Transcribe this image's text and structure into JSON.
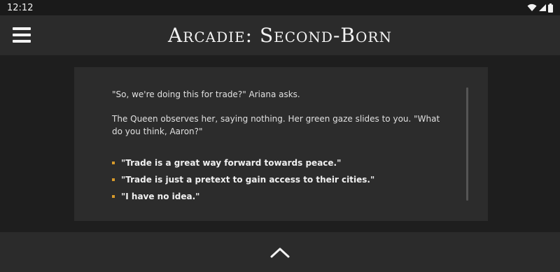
{
  "status_bar": {
    "time": "12:12",
    "icons": [
      "wifi-icon",
      "signal-icon",
      "battery-icon"
    ]
  },
  "app_bar": {
    "title": "Arcadie: Second-Born",
    "menu_icon": "hamburger-menu-icon"
  },
  "story": {
    "paragraphs": [
      "\"So, we're doing this for trade?\" Ariana asks.",
      "The Queen observes her, saying nothing. Her green gaze slides to you. \"What do you think, Aaron?\""
    ],
    "choices": [
      "\"Trade is a great way forward towards peace.\"",
      "\"Trade is just a pretext to gain access to their cities.\"",
      "\"I have no idea.\""
    ]
  },
  "bottom_bar": {
    "icon": "chevron-up-icon"
  },
  "colors": {
    "accent": "#d79a2b",
    "background": "#1e1e1e",
    "bar": "#2b2b2b",
    "card": "#2c2c2c"
  }
}
